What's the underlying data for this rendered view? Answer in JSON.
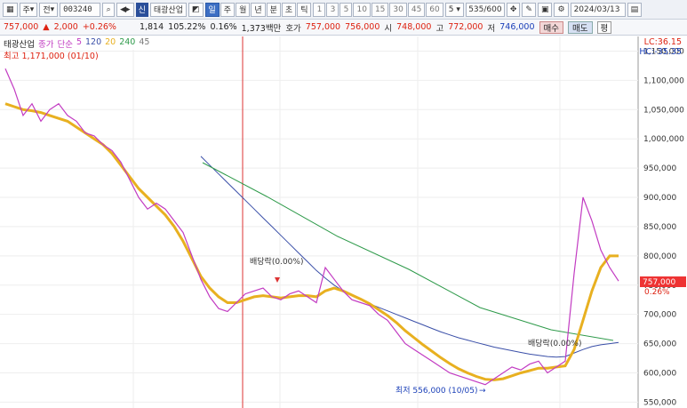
{
  "toolbar": {
    "market": "주",
    "period_mode": "전",
    "stock_code": "003240",
    "stock_tag": "신",
    "stock_name": "태광산업",
    "periods": [
      "일",
      "주",
      "월",
      "년",
      "분",
      "초",
      "틱"
    ],
    "active_period": "일",
    "intervals": [
      "1",
      "3",
      "5",
      "10",
      "15",
      "30",
      "45",
      "60"
    ],
    "interval_select": "5",
    "count": "535/600",
    "date": "2024/03/13"
  },
  "quote": {
    "price": "757,000",
    "change": "2,000",
    "change_pct": "+0.26%",
    "volume": "1,814",
    "volume_ratio": "105.22%",
    "turnover": "0.16%",
    "amount": "1,373백만",
    "ask_label": "호가",
    "ask1": "757,000",
    "ask2": "756,000",
    "open_label": "시",
    "open": "748,000",
    "high_label": "고",
    "high": "772,000",
    "low_label": "저",
    "low": "746,000",
    "buy_label": "매수",
    "sell_label": "매도",
    "avg_label": "평"
  },
  "legend": {
    "name": "태광산업",
    "price_label": "종가",
    "ma_label": "단순",
    "ma_periods": [
      "5",
      "120",
      "20",
      "240",
      "45"
    ],
    "ma_colors": [
      "#c23bc2",
      "#3a4fa8",
      "#e8b020",
      "#2e9a4a",
      "#7a7a7a"
    ],
    "high_note": "최고 1,171,000 (01/10)",
    "lc": "LC:36.15",
    "hc": "HC:-35.35"
  },
  "annotations": {
    "dividend1": "배당락(0.00%)",
    "dividend2": "배당락(0.00%)",
    "low_note": "최저 556,000 (10/05)",
    "last_price": "757,000",
    "last_pct": "0.26%"
  },
  "chart_data": {
    "type": "line",
    "y_ticks": [
      "1,150,000",
      "1,100,000",
      "1,050,000",
      "1,000,000",
      "950,000",
      "900,000",
      "850,000",
      "800,000",
      "750,000",
      "700,000",
      "650,000",
      "600,000",
      "550,000"
    ],
    "ylim": [
      540000,
      1175000
    ],
    "price": [
      1120000,
      1085000,
      1040000,
      1060000,
      1030000,
      1050000,
      1060000,
      1040000,
      1030000,
      1010000,
      1005000,
      990000,
      980000,
      960000,
      930000,
      900000,
      880000,
      890000,
      880000,
      860000,
      840000,
      800000,
      760000,
      730000,
      710000,
      705000,
      720000,
      735000,
      740000,
      745000,
      730000,
      725000,
      735000,
      740000,
      730000,
      720000,
      780000,
      760000,
      740000,
      725000,
      720000,
      715000,
      700000,
      690000,
      670000,
      650000,
      640000,
      630000,
      620000,
      610000,
      600000,
      595000,
      590000,
      585000,
      580000,
      590000,
      600000,
      610000,
      605000,
      615000,
      620000,
      600000,
      610000,
      620000,
      770000,
      900000,
      860000,
      810000,
      780000,
      757000
    ],
    "ma20": [
      1060000,
      1055000,
      1050000,
      1048000,
      1045000,
      1040000,
      1035000,
      1030000,
      1020000,
      1010000,
      1000000,
      990000,
      975000,
      955000,
      935000,
      915000,
      900000,
      885000,
      870000,
      850000,
      825000,
      795000,
      765000,
      745000,
      730000,
      720000,
      720000,
      725000,
      730000,
      732000,
      730000,
      728000,
      730000,
      732000,
      732000,
      730000,
      740000,
      745000,
      740000,
      733000,
      726000,
      718000,
      708000,
      698000,
      686000,
      672000,
      660000,
      648000,
      637000,
      626000,
      616000,
      607000,
      600000,
      594000,
      589000,
      588000,
      590000,
      595000,
      600000,
      604000,
      608000,
      608000,
      610000,
      612000,
      640000,
      690000,
      740000,
      780000,
      800000,
      800000
    ],
    "ma120": [
      null,
      null,
      null,
      null,
      null,
      null,
      null,
      null,
      null,
      null,
      null,
      null,
      null,
      null,
      null,
      null,
      null,
      null,
      null,
      null,
      null,
      null,
      970000,
      955000,
      940000,
      925000,
      910000,
      895000,
      880000,
      865000,
      850000,
      835000,
      820000,
      805000,
      790000,
      775000,
      762000,
      750000,
      740000,
      732000,
      725000,
      718000,
      712000,
      706000,
      700000,
      694000,
      688000,
      682000,
      676000,
      670000,
      665000,
      660000,
      656000,
      652000,
      648000,
      644000,
      641000,
      638000,
      635000,
      632000,
      630000,
      628000,
      627000,
      628000,
      634000,
      640000,
      645000,
      648000,
      650000,
      652000
    ]
  }
}
